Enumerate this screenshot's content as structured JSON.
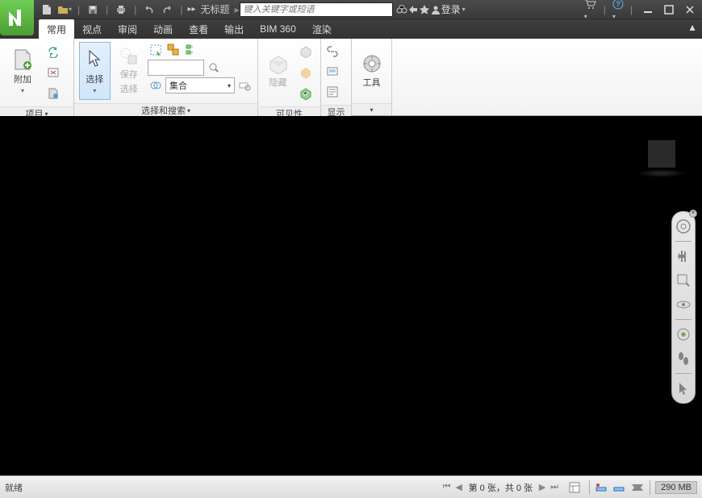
{
  "title": "无标题",
  "search": {
    "placeholder": "键入关键字或短语"
  },
  "login": {
    "label": "登录"
  },
  "tabs": [
    "常用",
    "视点",
    "审阅",
    "动画",
    "查看",
    "输出",
    "BIM 360",
    "渲染"
  ],
  "active_tab": 0,
  "ribbon": {
    "panels": [
      {
        "foot": "项目",
        "attach": "附加"
      },
      {
        "foot": "选择",
        "select": "选择",
        "save": "保存选择",
        "save1": "保存",
        "save2": "选择",
        "sets": "集合"
      },
      {
        "foot": "选择和搜索"
      },
      {
        "foot": "可见性",
        "hide": "隐藏"
      },
      {
        "foot": "显示"
      },
      {
        "tools": "工具"
      }
    ]
  },
  "status": {
    "ready": "就绪",
    "page": "第 0 张，共 0 张",
    "memory": "290 MB"
  }
}
